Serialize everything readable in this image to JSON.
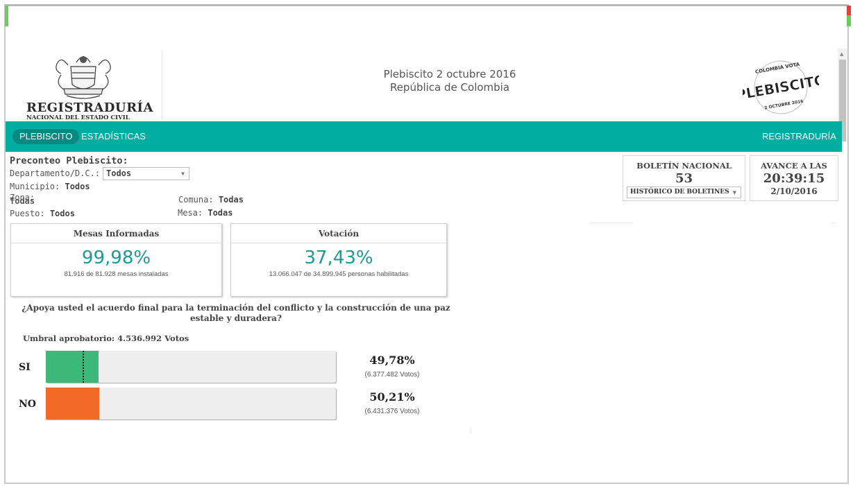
{
  "colors": {
    "teal": "#00ada1",
    "si": "#3cb878",
    "no": "#f26a25",
    "big_number": "#1c9a94"
  },
  "header": {
    "logo_line1": "REGISTRADURÍA",
    "logo_line2": "NACIONAL DEL ESTADO CIVIL",
    "title": "Plebiscito 2 octubre 2016",
    "subtitle": "República de Colombia",
    "badge": {
      "top": "COLOMBIA VOTA",
      "main": "PLEBISCITO",
      "bottom": "2 OCTUBRE 2016"
    }
  },
  "nav": {
    "active": "PLEBISCITO",
    "stats": "ESTADÍSTICAS",
    "right": "REGISTRADURÍA"
  },
  "filters": {
    "title": "Preconteo Plebiscito:",
    "departamento_label": "Departamento/D.C.:",
    "departamento_value": "Todos",
    "municipio_label": "Municipio:",
    "municipio_value": "Todos",
    "zona_label": "Zona:",
    "zona_value": "Todas",
    "comuna_label": "Comuna:",
    "comuna_value": "Todas",
    "puesto_label": "Puesto:",
    "puesto_value": "Todos",
    "mesa_label": "Mesa:",
    "mesa_value": "Todas"
  },
  "boletin": {
    "label": "BOLETÍN NACIONAL",
    "number": "53",
    "select": "HISTÓRICO DE BOLETINES"
  },
  "avance": {
    "label": "AVANCE A LAS",
    "time": "20:39:15",
    "date": "2/10/2016"
  },
  "mesas": {
    "title": "Mesas Informadas",
    "percent": "99,98%",
    "detail": "81.916 de 81.928 mesas instaladas"
  },
  "votacion": {
    "title": "Votación",
    "percent": "37,43%",
    "detail": "13.066.047 de 34.899.945 personas habilitadas"
  },
  "question": "¿Apoya usted el acuerdo final para la terminación del conflicto y la construcción de una paz estable y duradera?",
  "umbral": "Umbral aprobatorio: 4.536.992 Votos",
  "results": [
    {
      "label": "SI",
      "percent": "49,78%",
      "votes": "(6.377.482 Votos)",
      "bar_fraction": 0.182
    },
    {
      "label": "NO",
      "percent": "50,21%",
      "votes": "(6.431.376 Votos)",
      "bar_fraction": 0.184
    }
  ]
}
